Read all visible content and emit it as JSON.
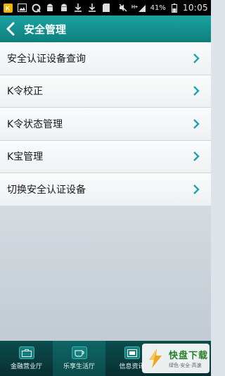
{
  "status_bar": {
    "battery": "41%",
    "time": "10:05",
    "network": "H+",
    "icons": [
      "app-k-icon",
      "image-icon",
      "q-icon",
      "android-icon",
      "android-icon",
      "download-icon",
      "download-icon",
      "sd-icon",
      "mute-icon",
      "signal-icon",
      "battery-icon"
    ]
  },
  "header": {
    "title": "安全管理",
    "back_icon": "chevron-left-icon"
  },
  "list": {
    "items": [
      {
        "label": "安全认证设备查询"
      },
      {
        "label": "K令校正"
      },
      {
        "label": "K令状态管理"
      },
      {
        "label": "K宝管理"
      },
      {
        "label": "切换安全认证设备"
      }
    ]
  },
  "tabbar": {
    "tabs": [
      {
        "label": "金融营业厅",
        "icon": "briefcase-icon"
      },
      {
        "label": "乐享生活厅",
        "icon": "cup-icon"
      },
      {
        "label": "信息资讯",
        "icon": "news-icon"
      },
      {
        "label": "",
        "icon": "more-icon"
      }
    ]
  },
  "watermark": {
    "title": "快盘下载",
    "subtitle": "绿色·安全·高速"
  },
  "colors": {
    "header": "#14918f",
    "chevron": "#1aa3b0",
    "tabbar": "#0a3f41"
  }
}
